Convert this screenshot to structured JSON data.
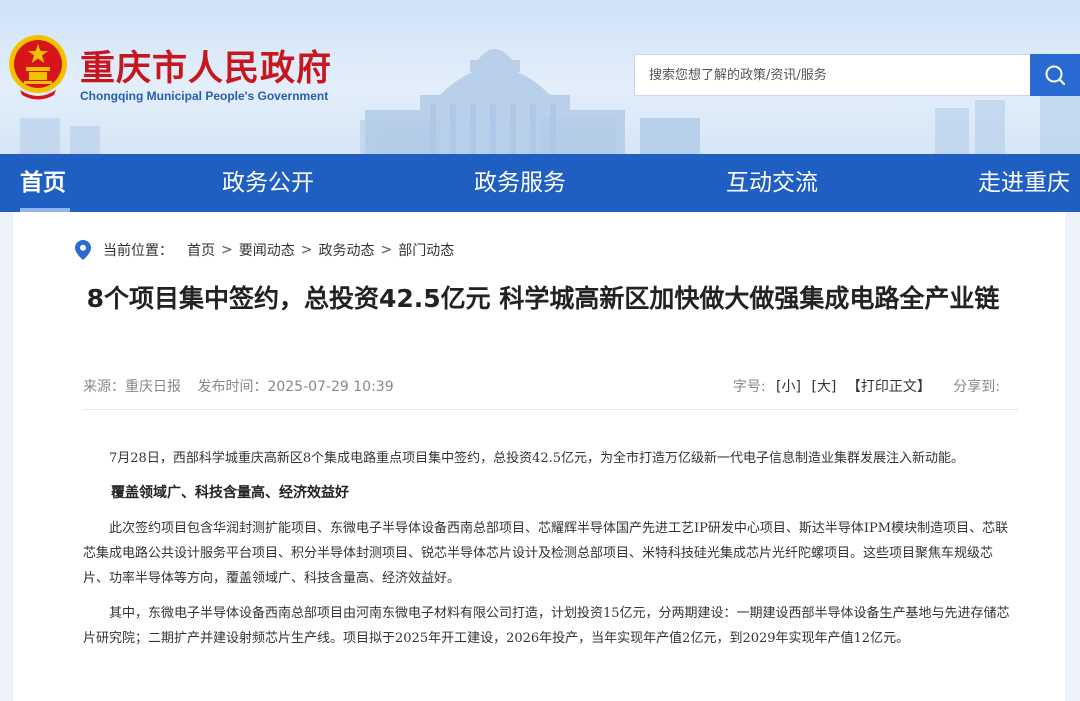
{
  "header": {
    "title": "重庆市人民政府",
    "subtitle": "Chongqing Municipal People's Government",
    "search_placeholder": "搜索您想了解的政策/资讯/服务"
  },
  "nav": {
    "items": [
      "首页",
      "政务公开",
      "政务服务",
      "互动交流",
      "走进重庆"
    ],
    "active": "首页"
  },
  "breadcrumb": {
    "label": "当前位置：",
    "items": [
      "首页",
      "要闻动态",
      "政务动态",
      "部门动态"
    ],
    "separator": ">"
  },
  "article": {
    "title": "8个项目集中签约，总投资42.5亿元 科学城高新区加快做大做强集成电路全产业链",
    "source": "来源：重庆日报",
    "publish_time": "发布时间：2025-07-29 10:39",
    "font_size_label": "字号:",
    "font_small": "[小]",
    "font_large": "[大]",
    "print": "【打印正文】",
    "share": "分享到:",
    "para1": "7月28日，西部科学城重庆高新区8个集成电路重点项目集中签约，总投资42.5亿元，为全市打造万亿级新一代电子信息制造业集群发展注入新动能。",
    "heading1": "覆盖领域广、科技含量高、经济效益好",
    "para2": "此次签约项目包含华润封测扩能项目、东微电子半导体设备西南总部项目、芯耀辉半导体国产先进工艺IP研发中心项目、斯达半导体IPM模块制造项目、芯联芯集成电路公共设计服务平台项目、积分半导体封测项目、锐芯半导体芯片设计及检测总部项目、米特科技硅光集成芯片光纤陀螺项目。这些项目聚焦车规级芯片、功率半导体等方向，覆盖领域广、科技含量高、经济效益好。",
    "para3": "其中，东微电子半导体设备西南总部项目由河南东微电子材料有限公司打造，计划投资15亿元，分两期建设：一期建设西部半导体设备生产基地与先进存储芯片研究院；二期扩产并建设射频芯片生产线。项目拟于2025年开工建设，2026年投产，当年实现年产值2亿元，到2029年实现年产值12亿元。"
  },
  "colors": {
    "brand_red": "#c8161e",
    "nav_blue": "#1e5fc1",
    "search_blue": "#2a6ad3"
  }
}
